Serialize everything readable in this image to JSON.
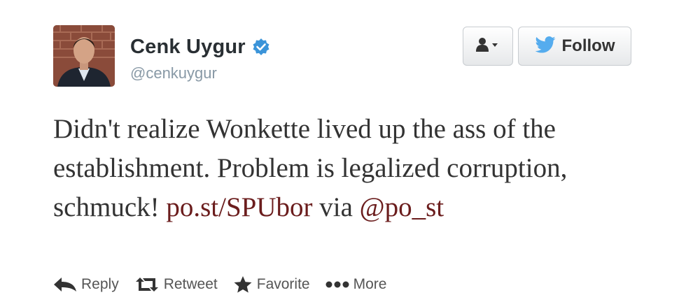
{
  "tweet": {
    "author": {
      "display_name": "Cenk Uygur",
      "screen_name": "@cenkuygur",
      "verified": true,
      "avatar_icon": "profile-photo"
    },
    "text_parts": {
      "plain_1": "Didn't realize Wonkette lived up the ass of the establishment. Problem is legalized corruption, schmuck! ",
      "link_1": "po.st/SPUbor",
      "plain_2": " via ",
      "mention_1": "@po_st"
    },
    "link_color": "#6b1d1d"
  },
  "header_buttons": {
    "user_menu_icon": "user-dropdown-icon",
    "follow_label": "Follow",
    "follow_icon": "bird-icon",
    "follow_icon_color": "#55acee"
  },
  "actions": [
    {
      "label": "Reply",
      "icon": "reply-arrow-icon"
    },
    {
      "label": "Retweet",
      "icon": "retweet-icon"
    },
    {
      "label": "Favorite",
      "icon": "star-icon"
    },
    {
      "label": "More",
      "icon": "more-dots-icon"
    }
  ],
  "colors": {
    "verified_badge": "#3b94d9",
    "text": "#333333",
    "screen_name": "#8899a6"
  }
}
